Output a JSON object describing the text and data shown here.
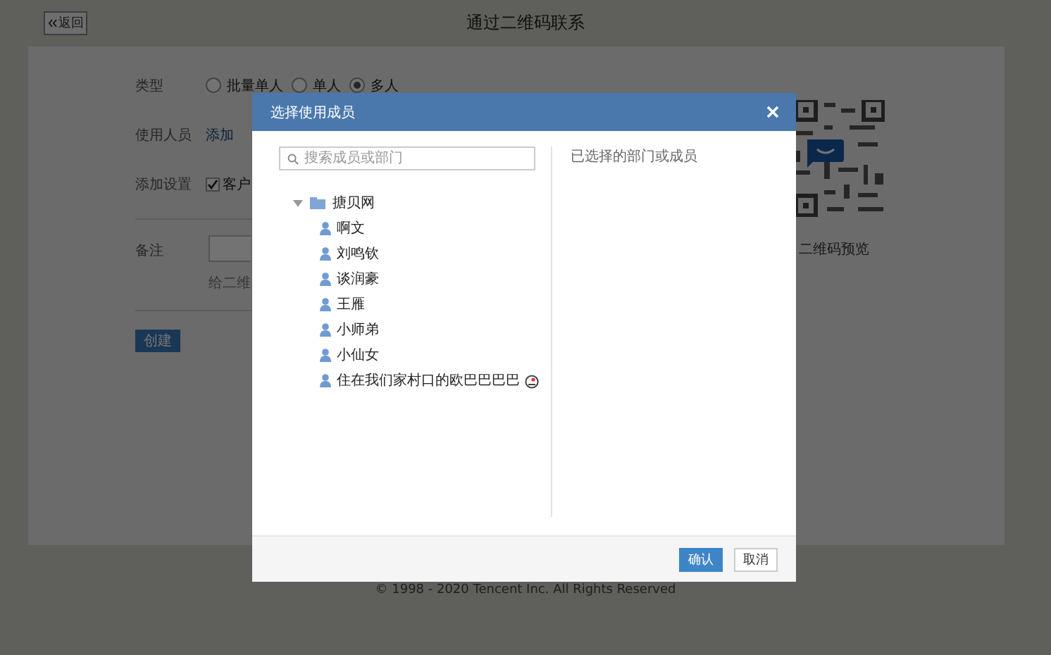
{
  "page": {
    "back_button": "返回",
    "title": "通过二维码联系",
    "form": {
      "type_label": "类型",
      "type_options": [
        {
          "label": "批量单人",
          "selected": false
        },
        {
          "label": "单人",
          "selected": false
        },
        {
          "label": "多人",
          "selected": true
        }
      ],
      "users_label": "使用人员",
      "add_link": "添加",
      "settings_label": "添加设置",
      "settings_option": {
        "label": "客户",
        "checked": true
      },
      "note_label": "备注",
      "note_hint": "给二维",
      "create_button": "创建"
    },
    "qr_caption": "二维码预览",
    "footer": "© 1998 - 2020 Tencent Inc. All Rights Reserved"
  },
  "dialog": {
    "title": "选择使用成员",
    "search": {
      "placeholder": "搜索成员或部门"
    },
    "tree": [
      {
        "label": "搪贝网",
        "kind": "department",
        "expanded": true,
        "children": [
          {
            "label": "啊文",
            "kind": "member"
          },
          {
            "label": "刘鸣钦",
            "kind": "member"
          },
          {
            "label": "谈润豪",
            "kind": "member"
          },
          {
            "label": "王雁",
            "kind": "member"
          },
          {
            "label": "小师弟",
            "kind": "member"
          },
          {
            "label": "小仙女",
            "kind": "member"
          },
          {
            "label": "住在我们家村口的欧巴巴巴巴",
            "kind": "member",
            "badge": true
          }
        ]
      }
    ],
    "selected_heading": "已选择的部门或成员",
    "buttons": [
      {
        "label": "确认",
        "kind": "primary"
      },
      {
        "label": "取消",
        "kind": "secondary"
      }
    ]
  }
}
